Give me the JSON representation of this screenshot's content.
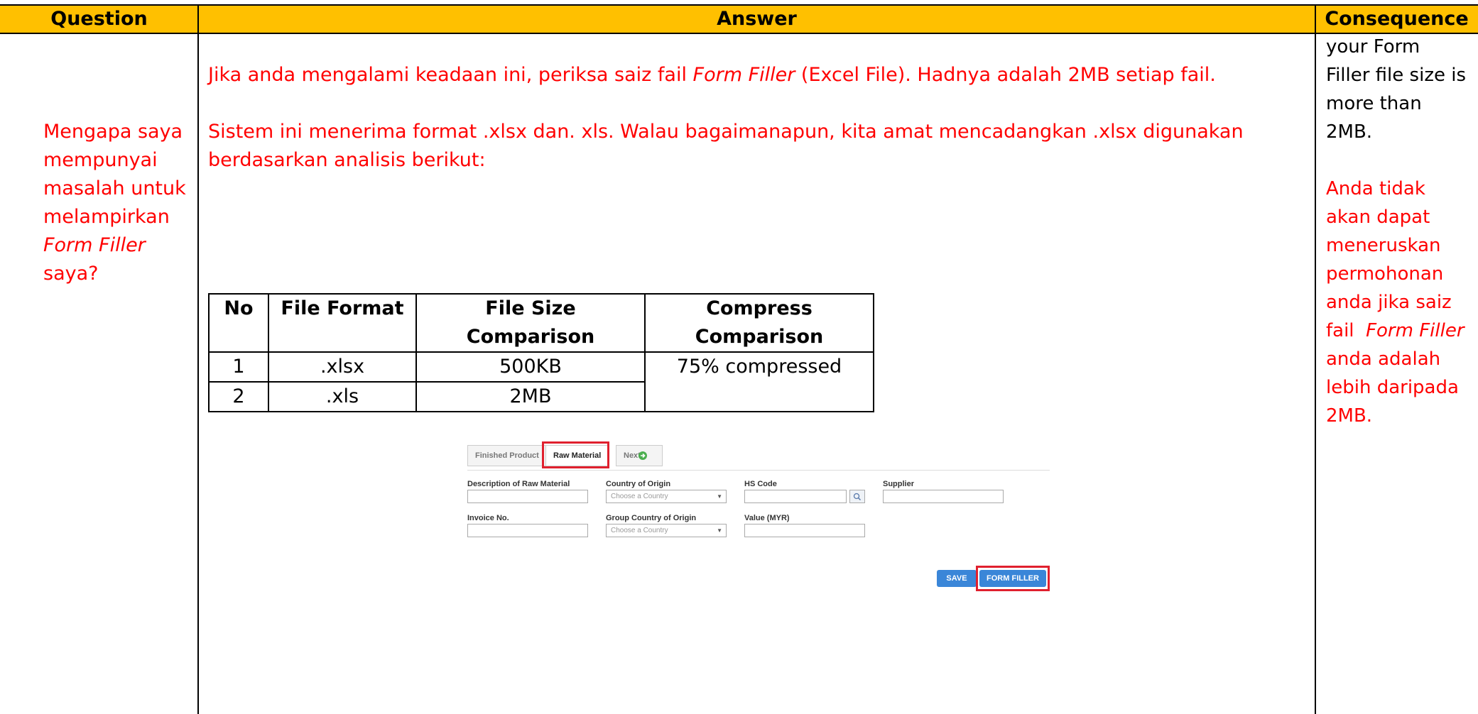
{
  "header": {
    "question": "Question",
    "answer": "Answer",
    "consequence": "Consequence"
  },
  "question": {
    "line1": "Mengapa saya",
    "line2": "mempunyai",
    "line3": "masalah untuk",
    "line4": "melampirkan",
    "line5": "Form Filler",
    "line6": "saya?"
  },
  "answer": {
    "p1_a": "Jika anda mengalami keadaan ini, periksa saiz fail ",
    "p1_b": "Form Filler",
    "p1_c": " (Excel File). Hadnya adalah 2MB setiap fail.",
    "p2_line1": "Sistem ini menerima format .xlsx dan. xls. Walau bagaimanapun, kita amat mencadangkan .xlsx digunakan",
    "p2_line2": "berdasarkan analisis berikut:"
  },
  "table": {
    "headers": [
      "No",
      "File Format",
      "File Size Comparison",
      "Compress Comparison"
    ],
    "h3_line1": "File Size",
    "h3_line2": "Comparison",
    "h4_line1": "Compress",
    "h4_line2": "Comparison",
    "rows": [
      {
        "no": "1",
        "format": ".xlsx",
        "size": "500KB"
      },
      {
        "no": "2",
        "format": ".xls",
        "size": "2MB"
      }
    ],
    "compress": "75% compressed"
  },
  "screenshot": {
    "tab1": "Finished Product",
    "tab2": "Raw Material",
    "tab3": "Next",
    "desc_label": "Description of Raw Material",
    "country_label": "Country of Origin",
    "country_placeholder": "Choose a Country",
    "hs_label": "HS Code",
    "supplier_label": "Supplier",
    "invoice_label": "Invoice No.",
    "group_label": "Group Country of Origin",
    "group_placeholder": "Choose a Country",
    "value_label": "Value (MYR)",
    "save": "SAVE",
    "form_filler": "FORM FILLER"
  },
  "consequence": {
    "b1": "your Form",
    "b2": "Filler file size is",
    "b3": "more than",
    "b4": "2MB.",
    "r1": "Anda tidak",
    "r2": "akan dapat",
    "r3": "meneruskan",
    "r4": "permohonan",
    "r5": "anda jika saiz",
    "r6a": "fail  ",
    "r6b": "Form Filler",
    "r7": "anda adalah",
    "r8": "lebih daripada",
    "r9": "2MB."
  },
  "colors": {
    "header_bg": "#FFC000",
    "text_red": "#FF0000",
    "highlight_box": "#E0202E",
    "button_blue": "#3a86d8"
  }
}
